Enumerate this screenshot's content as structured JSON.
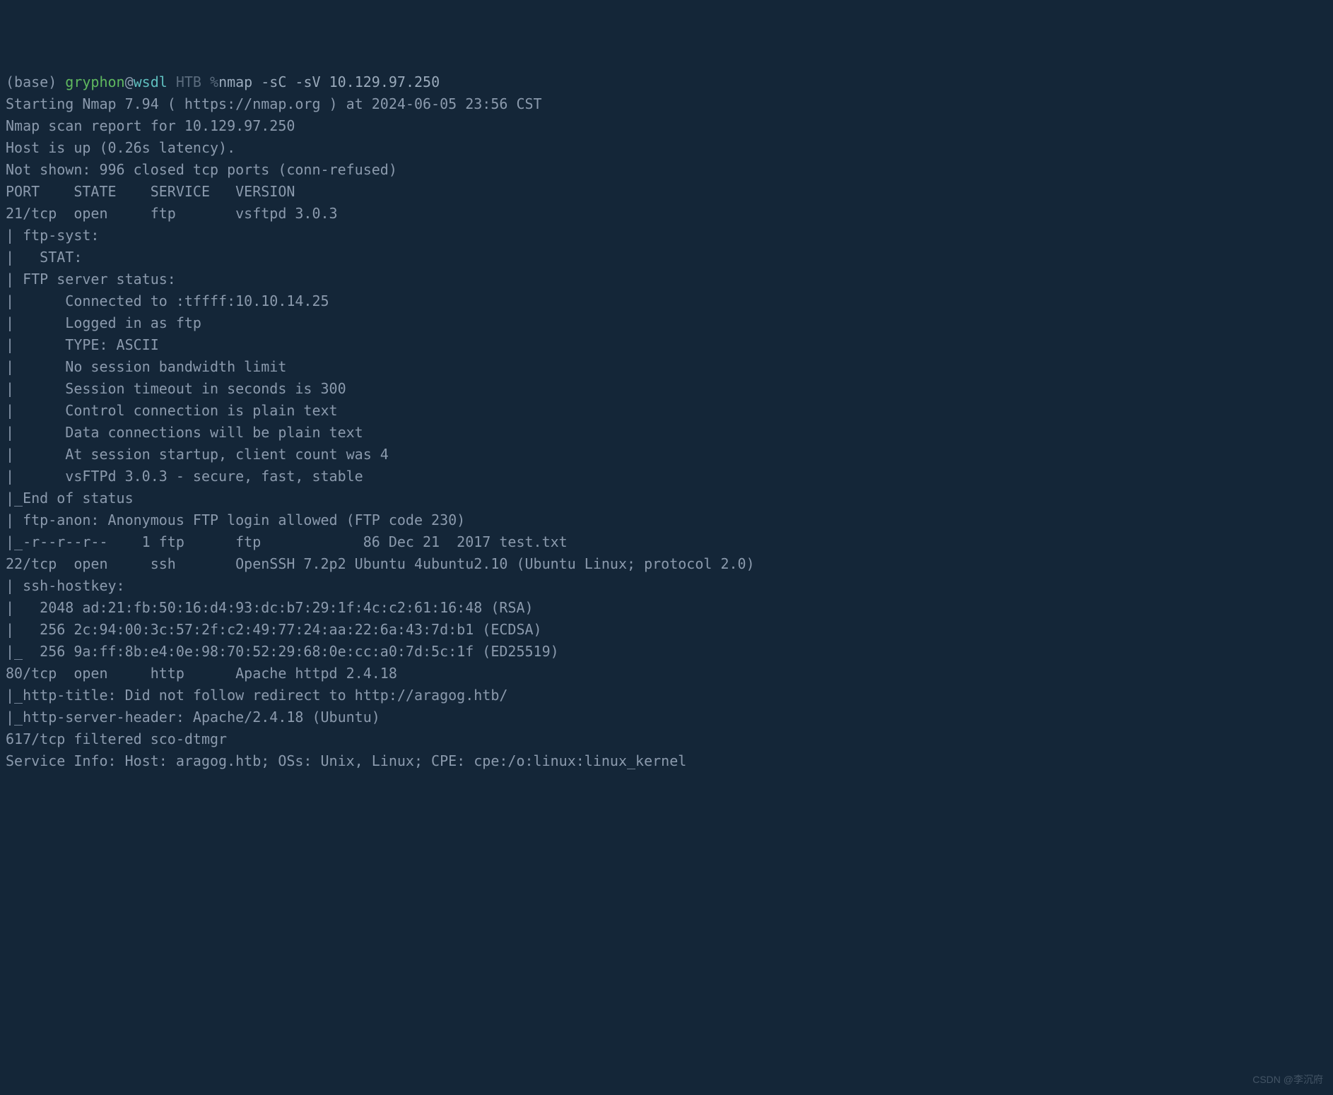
{
  "prompt": {
    "base": "(base) ",
    "user": "gryphon",
    "at": "@",
    "host": "wsdl",
    "path": " HTB %",
    "cmd": "nmap -sC -sV 10.129.97.250"
  },
  "lines": [
    "Starting Nmap 7.94 ( https://nmap.org ) at 2024-06-05 23:56 CST",
    "Nmap scan report for 10.129.97.250",
    "Host is up (0.26s latency).",
    "Not shown: 996 closed tcp ports (conn-refused)",
    "PORT    STATE    SERVICE   VERSION",
    "21/tcp  open     ftp       vsftpd 3.0.3",
    "| ftp-syst:",
    "|   STAT:",
    "| FTP server status:",
    "|      Connected to :tffff:10.10.14.25",
    "|      Logged in as ftp",
    "|      TYPE: ASCII",
    "|      No session bandwidth limit",
    "|      Session timeout in seconds is 300",
    "|      Control connection is plain text",
    "|      Data connections will be plain text",
    "|      At session startup, client count was 4",
    "|      vsFTPd 3.0.3 - secure, fast, stable",
    "|_End of status",
    "| ftp-anon: Anonymous FTP login allowed (FTP code 230)",
    "|_-r--r--r--    1 ftp      ftp            86 Dec 21  2017 test.txt",
    "22/tcp  open     ssh       OpenSSH 7.2p2 Ubuntu 4ubuntu2.10 (Ubuntu Linux; protocol 2.0)",
    "| ssh-hostkey:",
    "|   2048 ad:21:fb:50:16:d4:93:dc:b7:29:1f:4c:c2:61:16:48 (RSA)",
    "|   256 2c:94:00:3c:57:2f:c2:49:77:24:aa:22:6a:43:7d:b1 (ECDSA)",
    "|_  256 9a:ff:8b:e4:0e:98:70:52:29:68:0e:cc:a0:7d:5c:1f (ED25519)",
    "80/tcp  open     http      Apache httpd 2.4.18",
    "|_http-title: Did not follow redirect to http://aragog.htb/",
    "|_http-server-header: Apache/2.4.18 (Ubuntu)",
    "617/tcp filtered sco-dtmgr",
    "Service Info: Host: aragog.htb; OSs: Unix, Linux; CPE: cpe:/o:linux:linux_kernel"
  ],
  "watermark": "CSDN @李沉府"
}
